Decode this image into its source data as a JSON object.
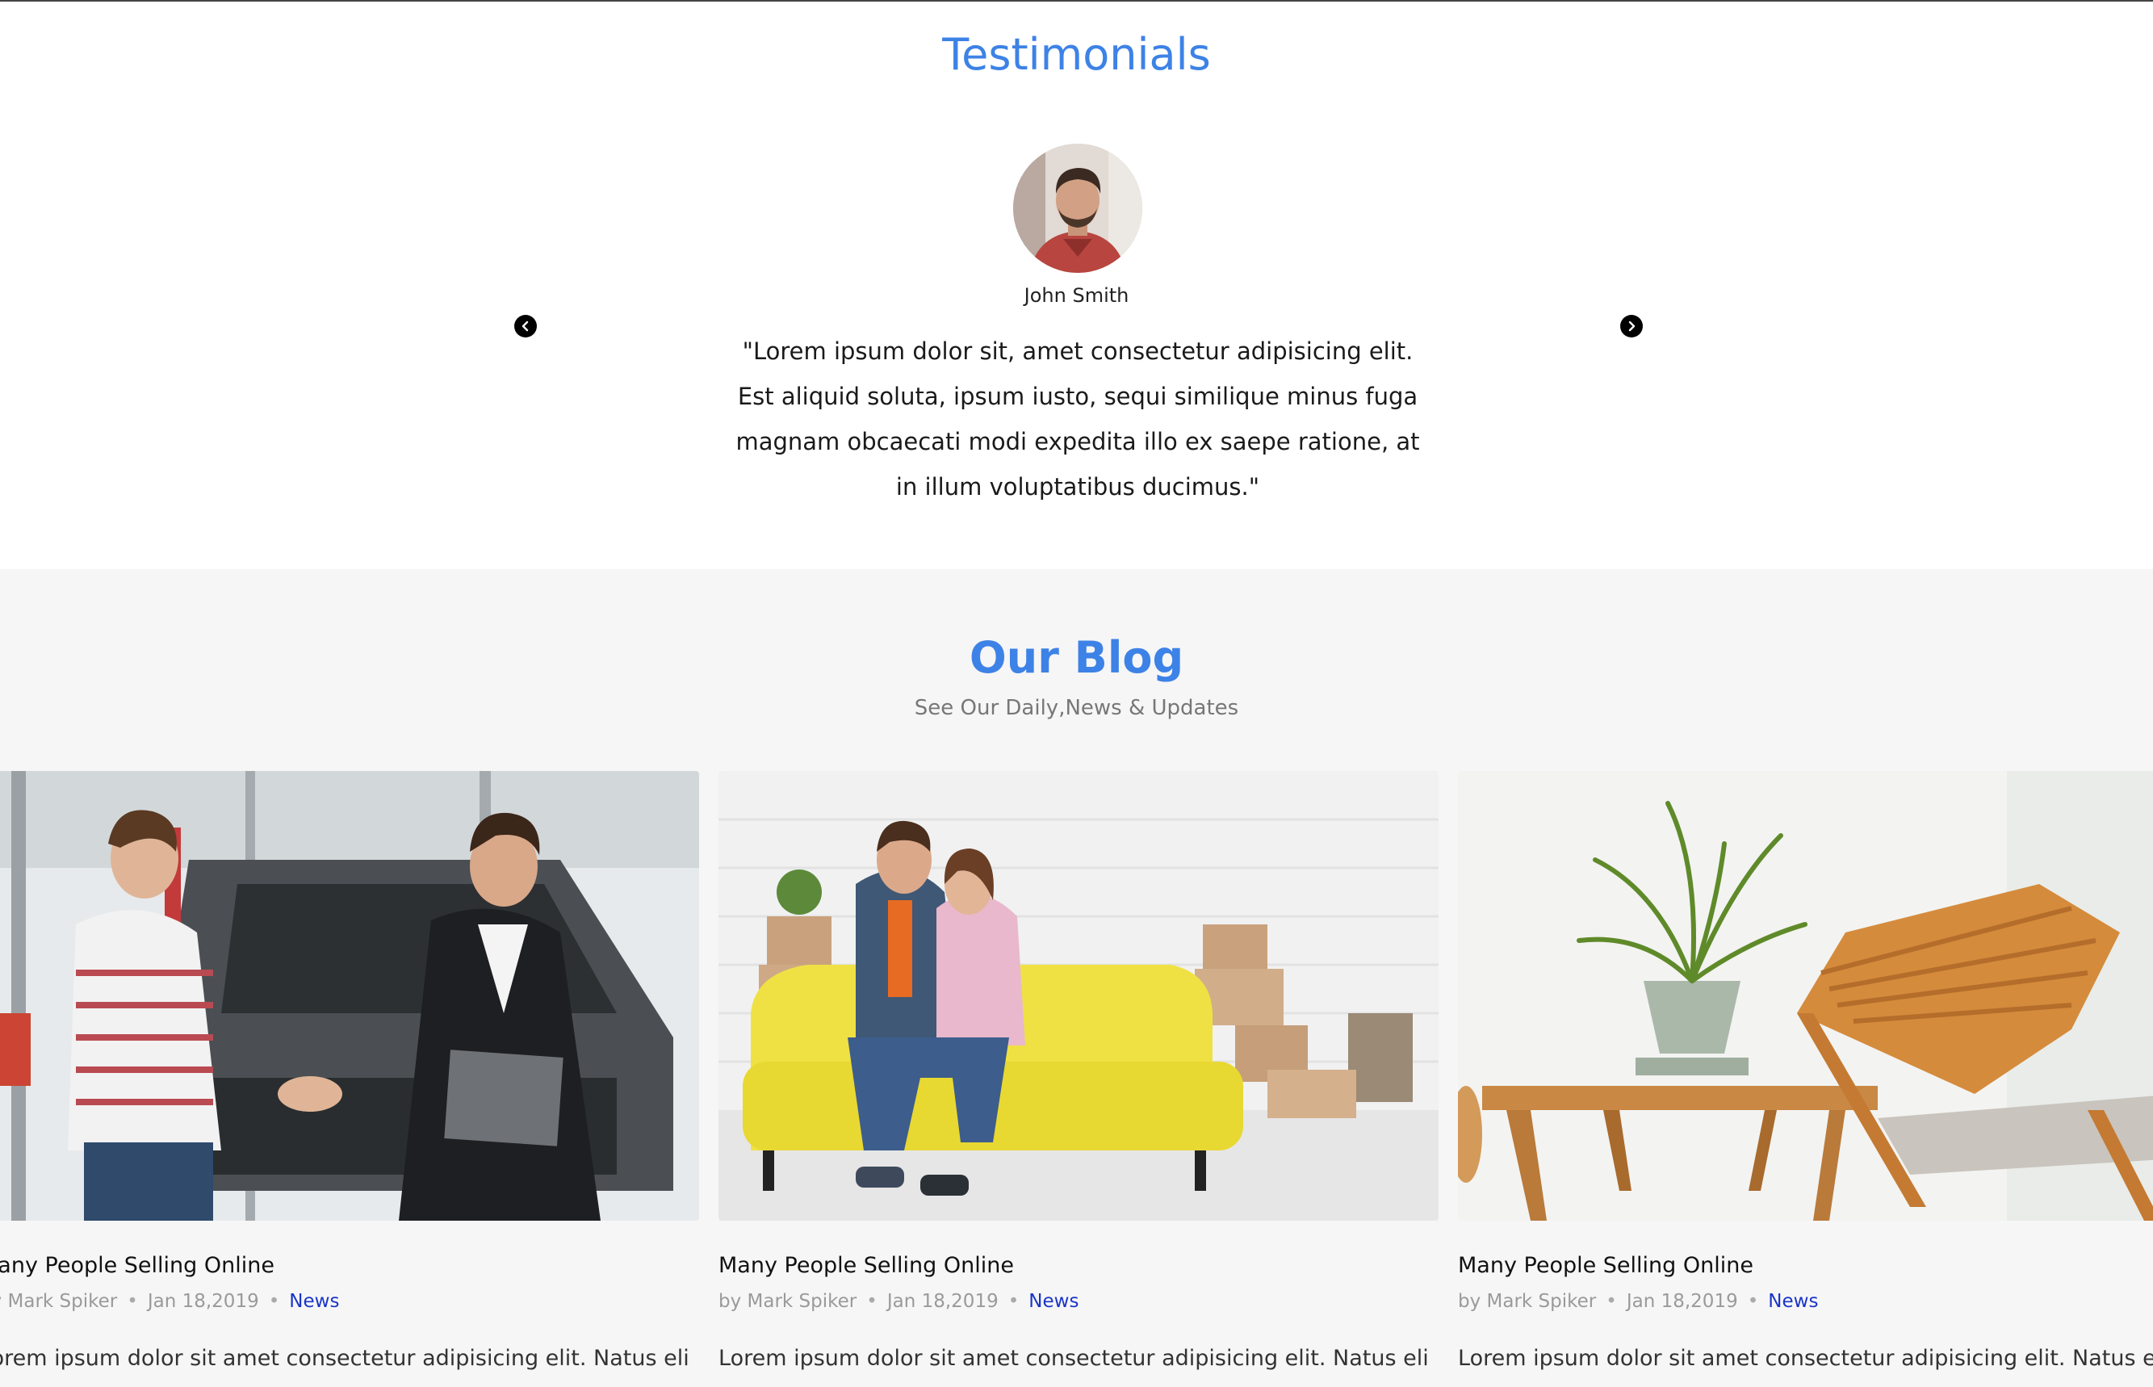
{
  "testimonials": {
    "title": "Testimonials",
    "name": "John Smith",
    "quote": "\"Lorem ipsum dolor sit, amet consectetur adipisicing elit. Est aliquid soluta, ipsum iusto, sequi similique minus fuga magnam obcaecati modi expedita illo ex saepe ratione, at in illum voluptatibus ducimus.\"",
    "prev_icon": "chevron-left-icon",
    "next_icon": "chevron-right-icon"
  },
  "blog": {
    "title": "Our Blog",
    "subtitle": "See Our Daily,News & Updates",
    "posts": [
      {
        "title": "Many People Selling Online",
        "author": "by Mark Spiker",
        "date": "Jan 18,2019",
        "category": "News",
        "excerpt": "Lorem ipsum dolor sit amet consectetur adipisicing elit. Natus eligendi nobis ea maiores sapiente veritatis reprehenderit suscipit quaerat rerum"
      },
      {
        "title": "Many People Selling Online",
        "author": "by Mark Spiker",
        "date": "Jan 18,2019",
        "category": "News",
        "excerpt": "Lorem ipsum dolor sit amet consectetur adipisicing elit. Natus eligendi nobis ea maiores sapiente veritatis reprehenderit suscipit quaerat rerum"
      },
      {
        "title": "Many People Selling Online",
        "author": "by Mark Spiker",
        "date": "Jan 18,2019",
        "category": "News",
        "excerpt": "Lorem ipsum dolor sit amet consectetur adipisicing elit. Natus eligendi nobis ea maiores sapiente veritatis reprehenderit suscipit quaerat rerum"
      }
    ]
  },
  "colors": {
    "accent": "#3d82e6",
    "category_link": "#1b35c8",
    "blog_background": "#f6f6f6"
  }
}
